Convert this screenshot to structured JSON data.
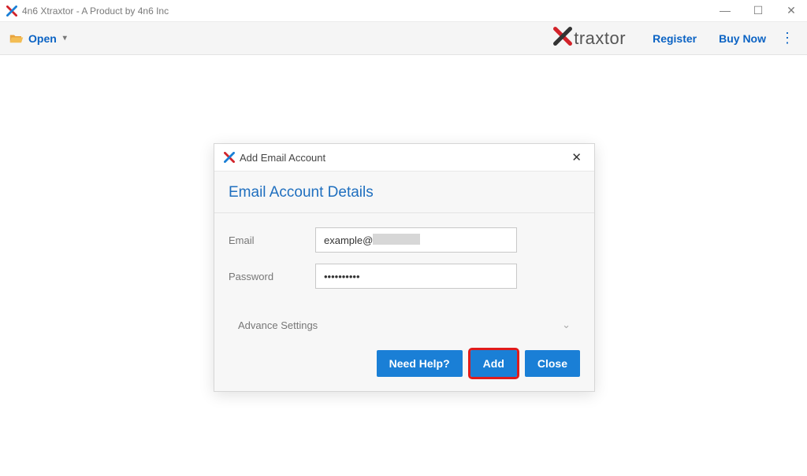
{
  "window": {
    "title": "4n6 Xtraxtor - A Product by 4n6 Inc"
  },
  "toolbar": {
    "open_label": "Open",
    "register_label": "Register",
    "buynow_label": "Buy Now"
  },
  "brand": {
    "text": "traxtor"
  },
  "modal": {
    "title": "Add Email Account",
    "section_title": "Email Account Details",
    "email_label": "Email",
    "email_value": "example@",
    "password_label": "Password",
    "password_value": "••••••••••",
    "advance_label": "Advance Settings",
    "buttons": {
      "help": "Need Help?",
      "add": "Add",
      "close": "Close"
    }
  }
}
